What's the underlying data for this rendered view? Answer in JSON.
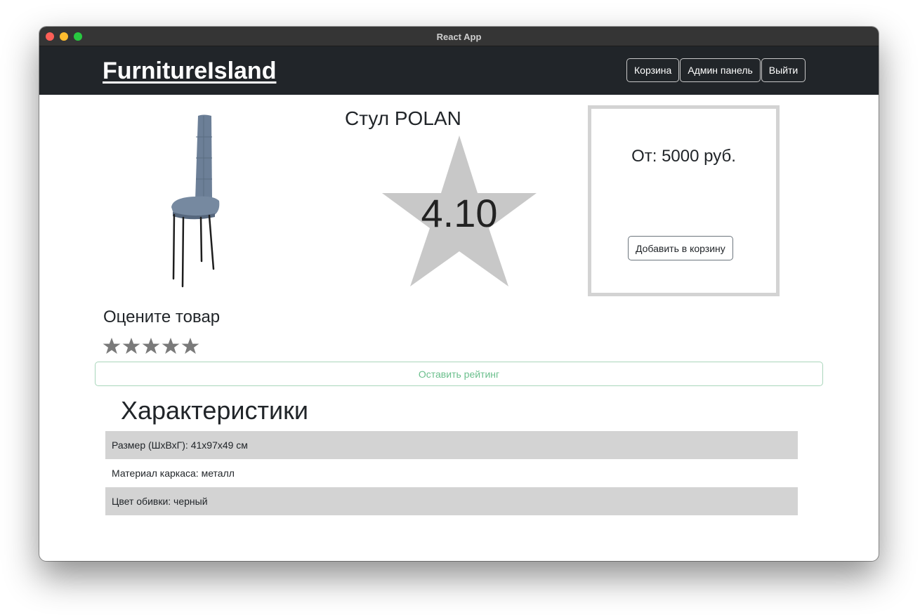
{
  "window": {
    "title": "React App"
  },
  "navbar": {
    "brand": "FurnitureIsland",
    "buttons": {
      "cart": "Корзина",
      "admin": "Админ панель",
      "logout": "Выйти"
    }
  },
  "product": {
    "title": "Стул POLAN",
    "rating": "4.10",
    "price": "От: 5000 руб.",
    "add_to_cart_label": "Добавить в корзину"
  },
  "rate_section": {
    "heading": "Оцените товар",
    "stars": 5,
    "selected_stars": 0,
    "submit_label": "Оставить рейтинг"
  },
  "specs": {
    "heading": "Характеристики",
    "rows": [
      {
        "text": "Размер (ШхВхГ): 41х97х49 см"
      },
      {
        "text": "Материал каркаса: металл"
      },
      {
        "text": "Цвет обивки: черный"
      }
    ]
  },
  "colors": {
    "navbar": "#212529",
    "star": "#c8c8c8",
    "rate_star": "#7a7a7a",
    "spec_shade": "#d3d3d3",
    "success": "#6bbf8d"
  }
}
